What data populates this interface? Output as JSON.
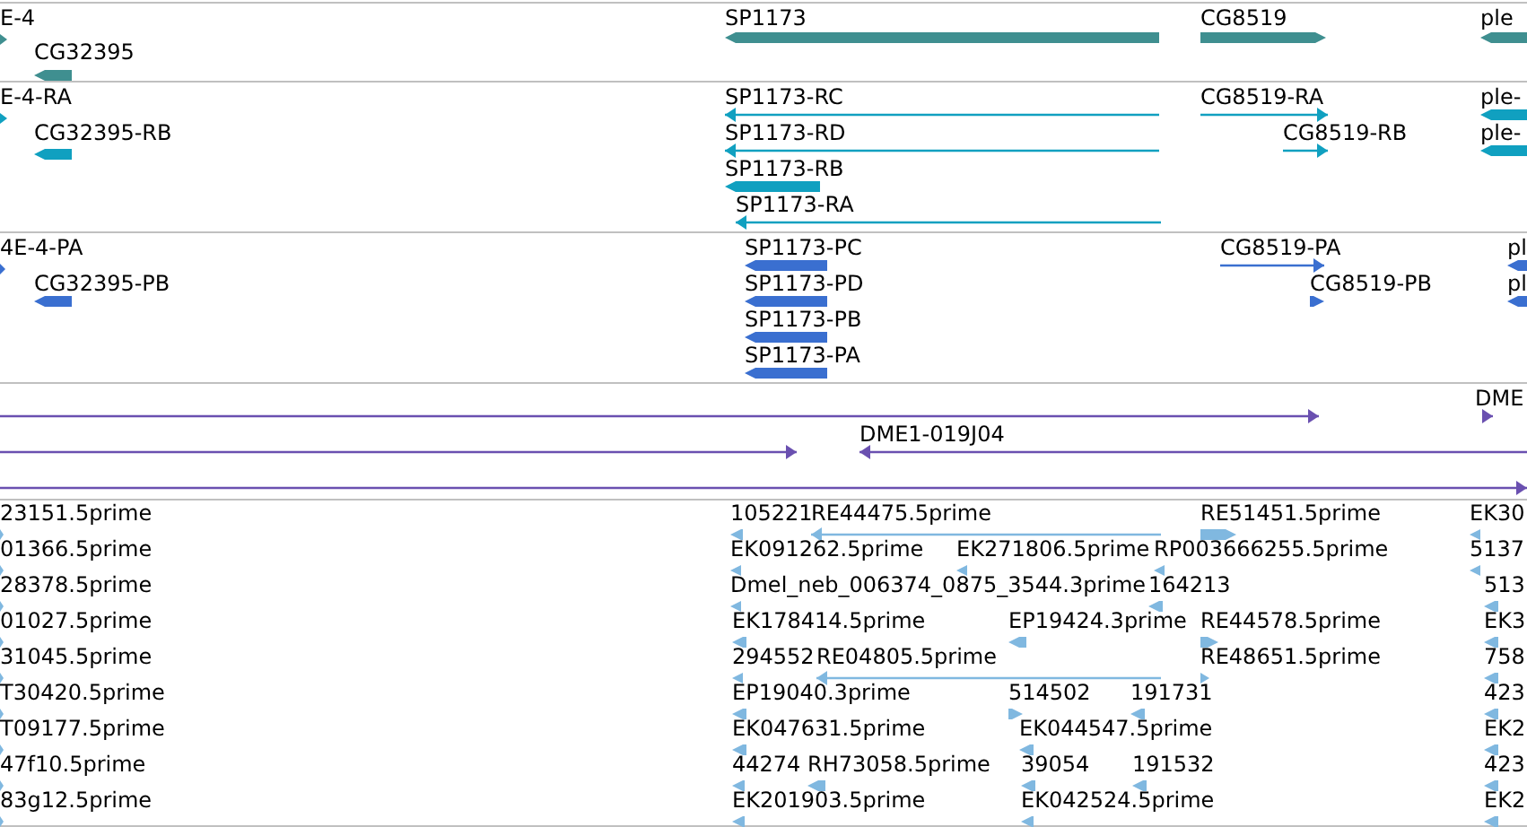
{
  "tracks": [
    {
      "color": "#3f8f90",
      "features": [
        {
          "label": "E-4",
          "reverse": false
        },
        {
          "label": "CG32395",
          "reverse": true
        },
        {
          "label": "SP1173",
          "reverse": true
        },
        {
          "label": "CG8519",
          "reverse": false
        },
        {
          "label": "ple",
          "reverse": true
        }
      ]
    },
    {
      "color": "#10a0c0",
      "features": [
        {
          "label": "E-4-RA",
          "reverse": false
        },
        {
          "label": "CG32395-RB",
          "reverse": true
        },
        {
          "label": "SP1173-RC",
          "reverse": true
        },
        {
          "label": "SP1173-RD",
          "reverse": true
        },
        {
          "label": "SP1173-RB",
          "reverse": true
        },
        {
          "label": "SP1173-RA",
          "reverse": true
        },
        {
          "label": "CG8519-RA",
          "reverse": false
        },
        {
          "label": "CG8519-RB",
          "reverse": false
        },
        {
          "label": "ple-",
          "reverse": true
        },
        {
          "label": "ple-",
          "reverse": true
        }
      ]
    },
    {
      "color": "#3a6fd0",
      "features": [
        {
          "label": "4E-4-PA",
          "reverse": false
        },
        {
          "label": "CG32395-PB",
          "reverse": true
        },
        {
          "label": "SP1173-PC",
          "reverse": true
        },
        {
          "label": "SP1173-PD",
          "reverse": true
        },
        {
          "label": "SP1173-PB",
          "reverse": true
        },
        {
          "label": "SP1173-PA",
          "reverse": true
        },
        {
          "label": "CG8519-PA",
          "reverse": false
        },
        {
          "label": "CG8519-PB",
          "reverse": false
        },
        {
          "label": "pl",
          "reverse": true
        },
        {
          "label": "pl",
          "reverse": true
        }
      ]
    },
    {
      "color": "#6a50b0",
      "features": [
        {
          "reverse": false
        },
        {
          "label": "DME",
          "reverse": false
        },
        {
          "reverse": false
        },
        {
          "label": "DME1-019J04",
          "reverse": true
        },
        {
          "reverse": false
        }
      ]
    },
    {
      "color": "#80b8e0",
      "features": [
        {
          "label": "23151.5prime",
          "reverse": false
        },
        {
          "label": "105221",
          "reverse": true
        },
        {
          "label": "RE44475.5prime",
          "reverse": true
        },
        {
          "label": "RE51451.5prime",
          "reverse": false
        },
        {
          "label": "EK30",
          "reverse": true
        },
        {
          "label": "01366.5prime",
          "reverse": false
        },
        {
          "label": "EK091262.5prime",
          "reverse": true
        },
        {
          "label": "EK271806.5prime",
          "reverse": true
        },
        {
          "label": "RP003666255.5prime",
          "reverse": true
        },
        {
          "label": "5137",
          "reverse": true
        },
        {
          "label": "28378.5prime",
          "reverse": false
        },
        {
          "label": "Dmel_neb_006374_0875_3544.3prime",
          "reverse": true
        },
        {
          "label": "164213",
          "reverse": true
        },
        {
          "label": "513",
          "reverse": true
        },
        {
          "label": "01027.5prime",
          "reverse": false
        },
        {
          "label": "EK178414.5prime",
          "reverse": true
        },
        {
          "label": "EP19424.3prime",
          "reverse": true
        },
        {
          "label": "RE44578.5prime",
          "reverse": false
        },
        {
          "label": "EK3",
          "reverse": true
        },
        {
          "label": "31045.5prime",
          "reverse": false
        },
        {
          "label": "294552",
          "reverse": true
        },
        {
          "label": "RE04805.5prime",
          "reverse": true
        },
        {
          "label": "RE48651.5prime",
          "reverse": false
        },
        {
          "label": "758",
          "reverse": true
        },
        {
          "label": "T30420.5prime",
          "reverse": false
        },
        {
          "label": "EP19040.3prime",
          "reverse": true
        },
        {
          "label": "514502",
          "reverse": false
        },
        {
          "label": "191731",
          "reverse": true
        },
        {
          "label": "423",
          "reverse": true
        },
        {
          "label": "T09177.5prime",
          "reverse": false
        },
        {
          "label": "EK047631.5prime",
          "reverse": true
        },
        {
          "label": "EK044547.5prime",
          "reverse": true
        },
        {
          "label": "EK2",
          "reverse": true
        },
        {
          "label": "47f10.5prime",
          "reverse": false
        },
        {
          "label": "44274",
          "reverse": true
        },
        {
          "label": "RH73058.5prime",
          "reverse": true
        },
        {
          "label": "39054",
          "reverse": true
        },
        {
          "label": "191532",
          "reverse": true
        },
        {
          "label": "423",
          "reverse": true
        },
        {
          "label": "83g12.5prime",
          "reverse": false
        },
        {
          "label": "EK201903.5prime",
          "reverse": true
        },
        {
          "label": "EK042524.5prime",
          "reverse": true
        },
        {
          "label": "EK2",
          "reverse": true
        }
      ]
    }
  ]
}
